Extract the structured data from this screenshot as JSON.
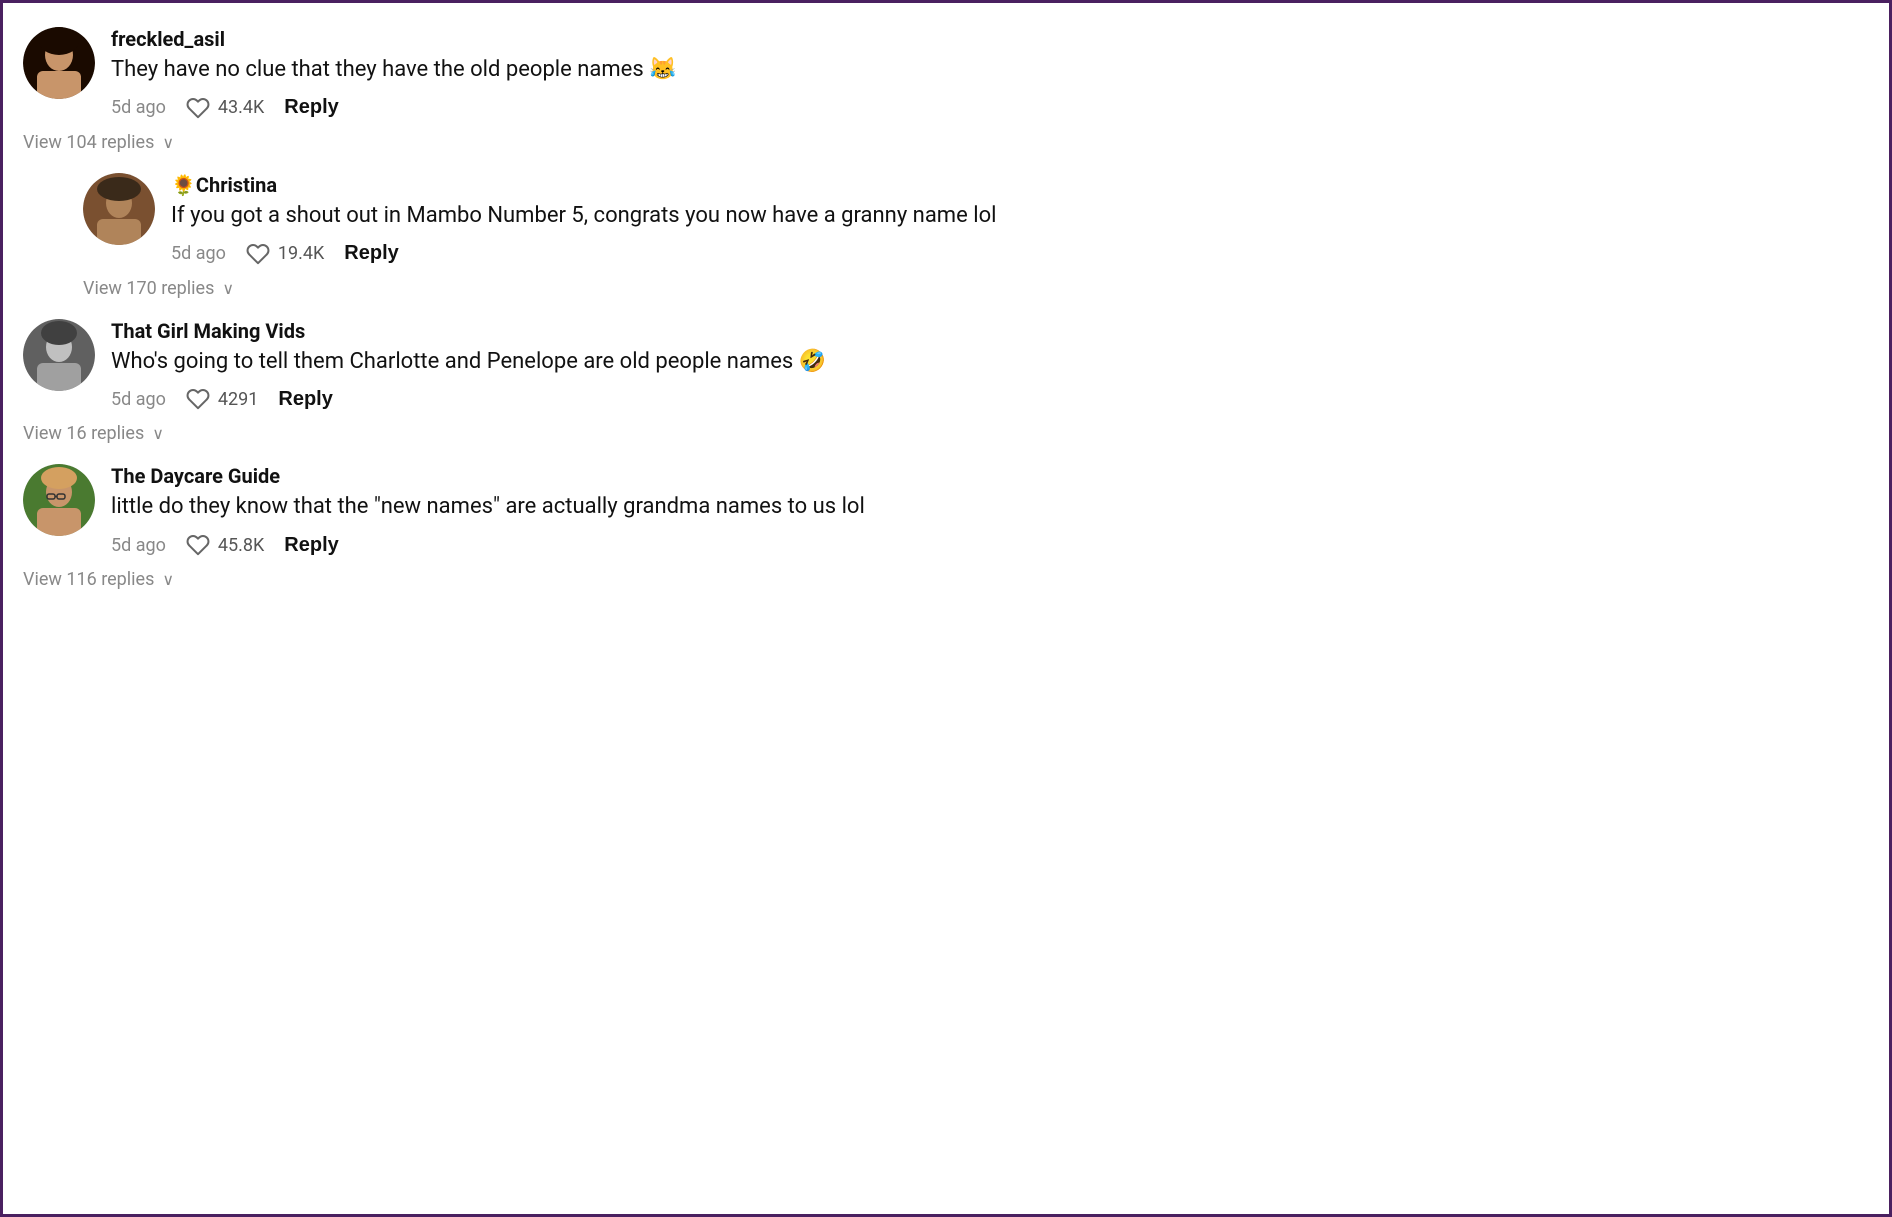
{
  "comments": [
    {
      "id": "comment-1",
      "username": "freckled_asil",
      "avatar_label": "freckled_asil avatar",
      "avatar_class": "avatar-1",
      "text": "They have no clue that they have the old people names 😹",
      "timestamp": "5d ago",
      "likes": "43.4K",
      "reply_label": "Reply",
      "view_replies_label": "View 104 replies",
      "nested": false
    },
    {
      "id": "comment-2",
      "username": "🌻Christina",
      "avatar_label": "Christina avatar",
      "avatar_class": "avatar-2",
      "text": "If you got a shout out in Mambo Number 5, congrats you now have a granny name lol",
      "timestamp": "5d ago",
      "likes": "19.4K",
      "reply_label": "Reply",
      "view_replies_label": "View 170 replies",
      "nested": true
    },
    {
      "id": "comment-3",
      "username": "That Girl Making Vids",
      "avatar_label": "That Girl Making Vids avatar",
      "avatar_class": "avatar-3",
      "text": "Who's going to tell them Charlotte and Penelope are old people names 🤣",
      "timestamp": "5d ago",
      "likes": "4291",
      "reply_label": "Reply",
      "view_replies_label": "View 16 replies",
      "nested": false
    },
    {
      "id": "comment-4",
      "username": "The Daycare Guide",
      "avatar_label": "The Daycare Guide avatar",
      "avatar_class": "avatar-4",
      "text": "little do they know that the \"new names\" are actually grandma names to us lol",
      "timestamp": "5d ago",
      "likes": "45.8K",
      "reply_label": "Reply",
      "view_replies_label": "View 116 replies",
      "nested": false
    }
  ]
}
